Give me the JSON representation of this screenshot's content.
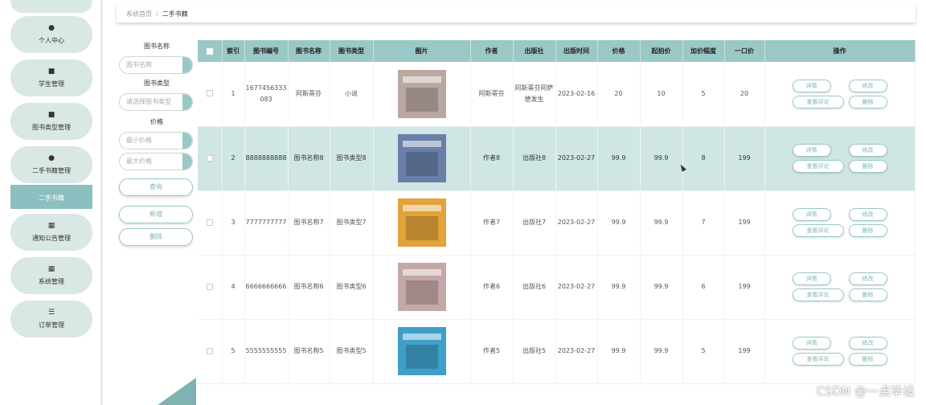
{
  "sidebar": {
    "items": [
      {
        "label": "个人中心",
        "icon": "user-icon",
        "glyph": "●"
      },
      {
        "label": "学生管理",
        "icon": "trash-icon",
        "glyph": "■"
      },
      {
        "label": "图书类型管理",
        "icon": "video-icon",
        "glyph": "■"
      },
      {
        "label": "二手书籍管理",
        "icon": "user-icon",
        "glyph": "●"
      },
      {
        "label": "二手书籍",
        "icon": "",
        "glyph": ""
      },
      {
        "label": "通知公告管理",
        "icon": "grid-icon",
        "glyph": "▦"
      },
      {
        "label": "系统管理",
        "icon": "grid-icon",
        "glyph": "▦"
      },
      {
        "label": "订单管理",
        "icon": "list-icon",
        "glyph": "☰"
      }
    ]
  },
  "breadcrumb": {
    "home": "系统首页",
    "sep": "/",
    "current": "二手书籍"
  },
  "search": {
    "name_label": "图书名称",
    "name_placeholder": "图书名称",
    "type_label": "图书类型",
    "type_placeholder": "请选择图书类型",
    "price_label": "价格",
    "min_placeholder": "最小价格",
    "max_placeholder": "最大价格",
    "query_button": "查询",
    "add_button": "新增",
    "delete_button": "删除"
  },
  "table": {
    "headers": [
      "索引",
      "图书编号",
      "图书名称",
      "图书类型",
      "图片",
      "作者",
      "出版社",
      "出版时间",
      "价格",
      "起拍价",
      "加价幅度",
      "一口价",
      "操作"
    ],
    "rows": [
      {
        "index": "1",
        "code": "1677456333083",
        "name": "阿斯蒂芬",
        "type": "小说",
        "author": "阿斯蒂芬",
        "publisher": "阿斯蒂芬阿萨德发生",
        "date": "2023-02-16",
        "price": "20",
        "start": "10",
        "inc": "5",
        "buyout": "20",
        "cover": "#b9a7a0"
      },
      {
        "index": "2",
        "code": "8888888888",
        "name": "图书名称8",
        "type": "图书类型8",
        "author": "作者8",
        "publisher": "出版社8",
        "date": "2023-02-27",
        "price": "99.9",
        "start": "99.9",
        "inc": "8",
        "buyout": "199",
        "cover": "#6a7fa8"
      },
      {
        "index": "3",
        "code": "7777777777",
        "name": "图书名称7",
        "type": "图书类型7",
        "author": "作者7",
        "publisher": "出版社7",
        "date": "2023-02-27",
        "price": "99.9",
        "start": "99.9",
        "inc": "7",
        "buyout": "199",
        "cover": "#e2a33a"
      },
      {
        "index": "4",
        "code": "6666666666",
        "name": "图书名称6",
        "type": "图书类型6",
        "author": "作者6",
        "publisher": "出版社6",
        "date": "2023-02-27",
        "price": "99.9",
        "start": "99.9",
        "inc": "6",
        "buyout": "199",
        "cover": "#c4a7a8"
      },
      {
        "index": "5",
        "code": "5555555555",
        "name": "图书名称5",
        "type": "图书类型5",
        "author": "作者5",
        "publisher": "出版社5",
        "date": "2023-02-27",
        "price": "99.9",
        "start": "99.9",
        "inc": "5",
        "buyout": "199",
        "cover": "#3f9fc9"
      }
    ],
    "actions": {
      "detail": "详情",
      "edit": "修改",
      "comments": "查看评论",
      "delete": "删除"
    }
  },
  "watermark": "CSDN @一点毕设"
}
